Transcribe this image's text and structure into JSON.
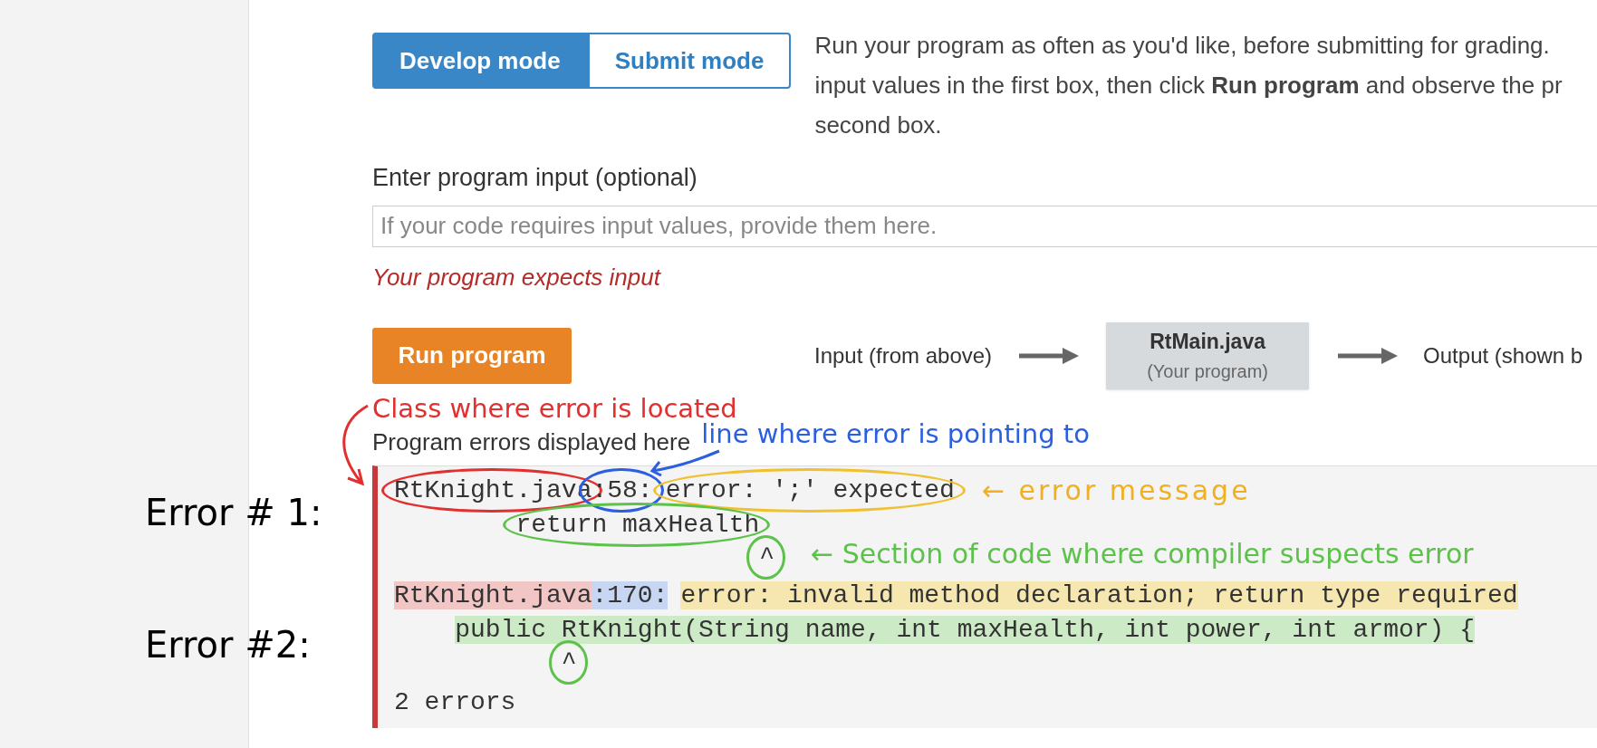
{
  "mode_toggle": [
    {
      "label": "Develop mode",
      "selected": true
    },
    {
      "label": "Submit mode",
      "selected": false
    }
  ],
  "instructions": [
    "Run your program as often as you'd like, before submitting for grading.",
    "input values in the first box, then click **Run program** and observe the pr",
    "second box."
  ],
  "input_section": {
    "label": "Enter program input (optional)",
    "placeholder": "If your code requires input values, provide them here.",
    "warning": "Your program expects input"
  },
  "run_button": "Run program",
  "flow": {
    "input": "Input (from above)",
    "program_name": "RtMain.java",
    "program_note": "(Your program)",
    "output": "Output (shown b"
  },
  "errors_label": "Program errors displayed here",
  "error_output": {
    "errors": [
      {
        "file": "RtKnight.java",
        "line_no": ":58:",
        "message": "error: ';' expected",
        "code": "        return maxHealth",
        "caret": "                        ^",
        "circled": true,
        "highlighted": false
      },
      {
        "file": "RtKnight.java",
        "line_no": ":170:",
        "message": "error: invalid method declaration; return type required",
        "code": "    public RtKnight(String name, int maxHealth, int power, int armor) {",
        "caret": "           ^",
        "circled": false,
        "highlighted": true
      }
    ],
    "summary": "2 errors"
  },
  "annotations": {
    "class_note": "Class where error is located",
    "line_note": "line where error is pointing to",
    "message_note": "← error message",
    "code_note": "← Section of code where compiler suspects error",
    "error_labels": [
      "Error # 1:",
      "Error #2:"
    ]
  }
}
